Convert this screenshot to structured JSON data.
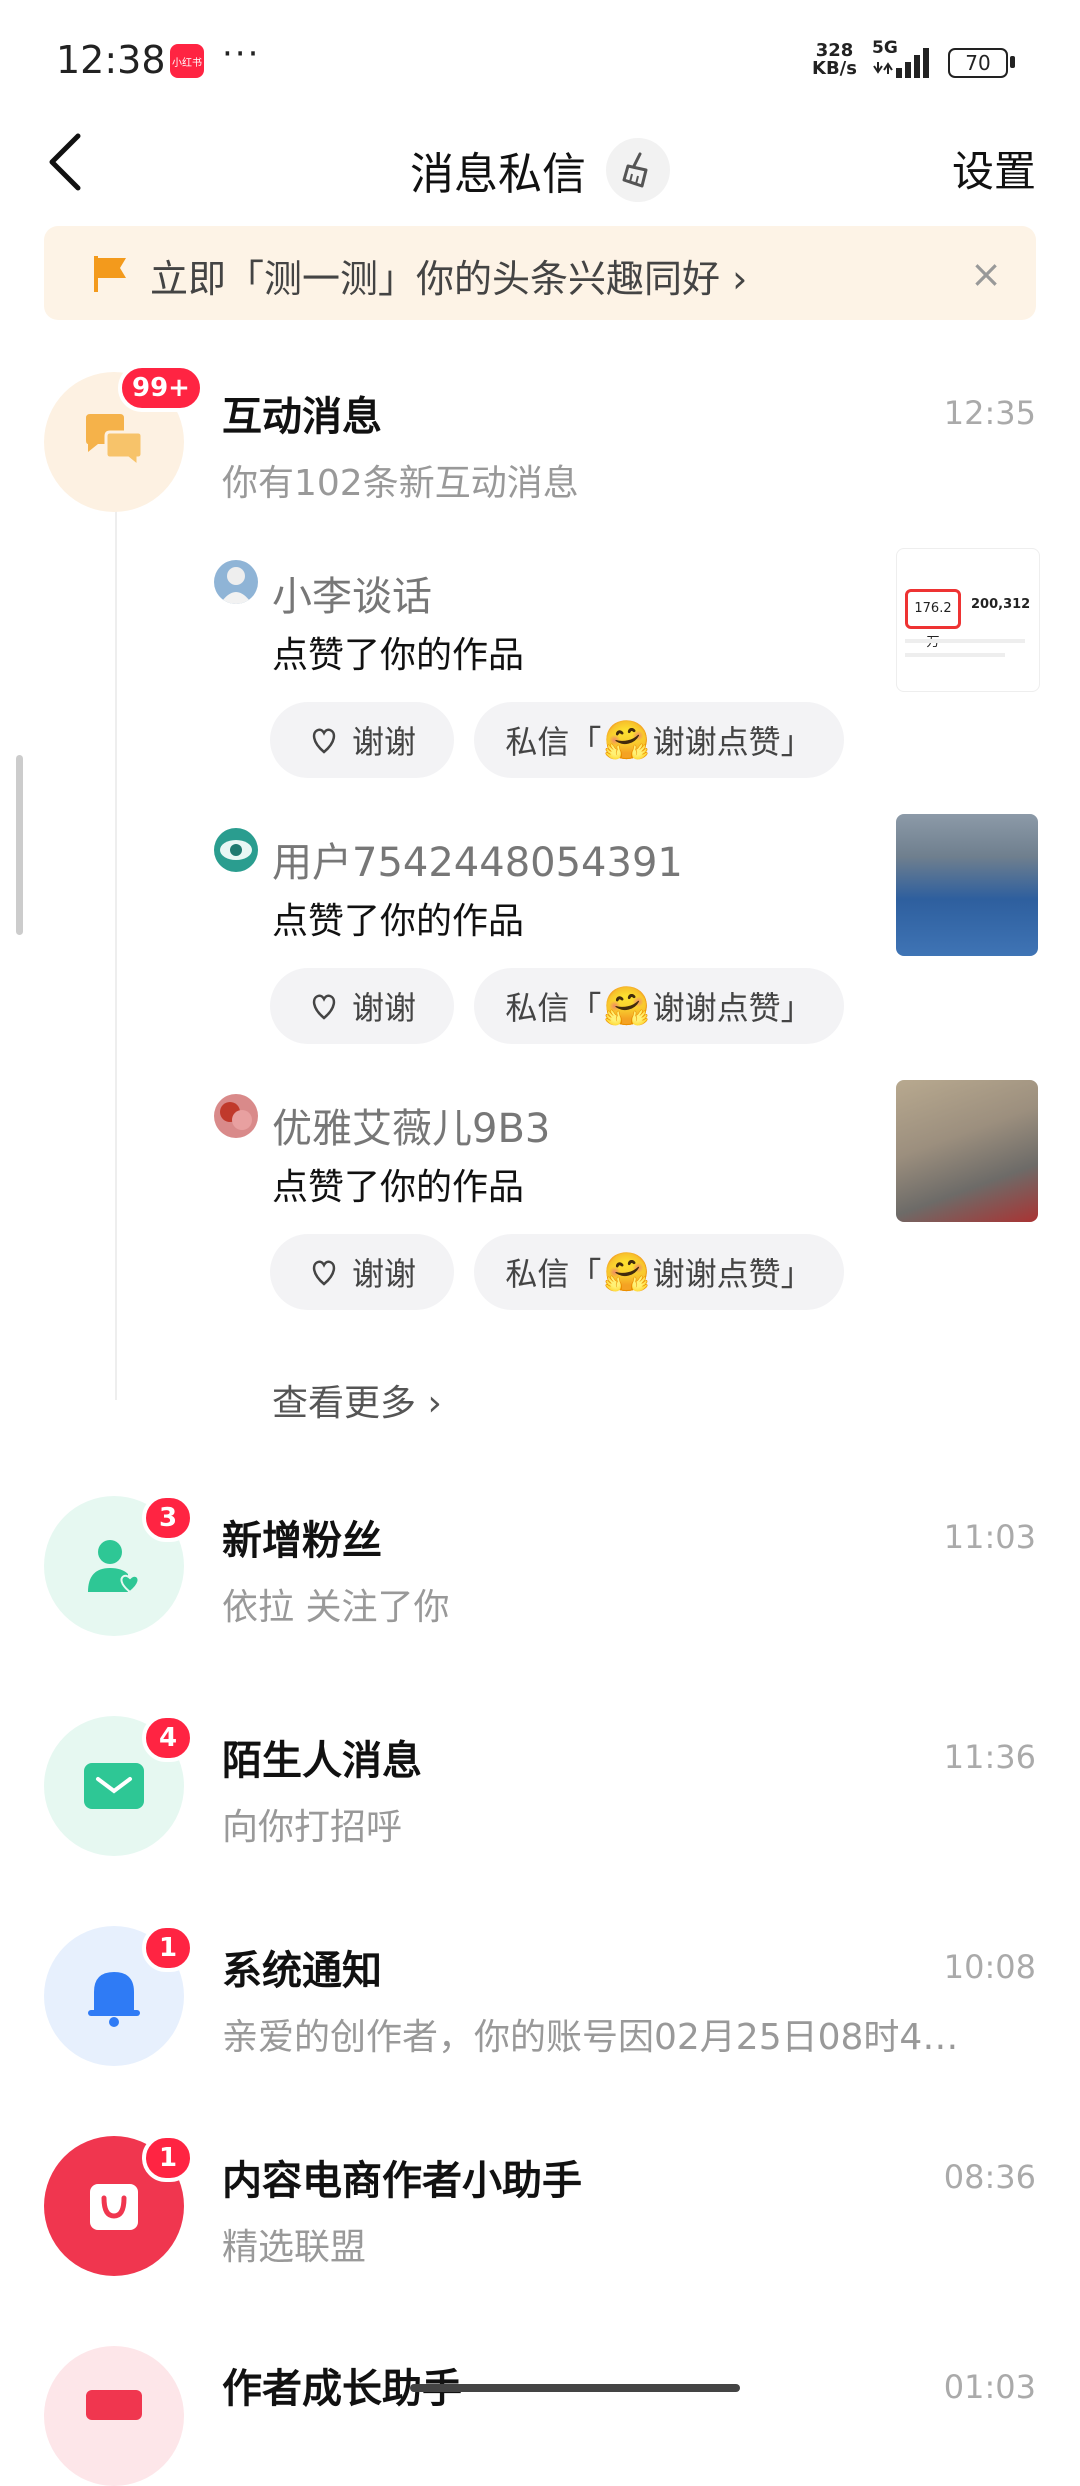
{
  "status_bar": {
    "time": "12:38",
    "app_icon_text": "小红书",
    "dots": "···",
    "net_speed_value": "328",
    "net_speed_unit": "KB/s",
    "network": "5G",
    "battery": "70"
  },
  "header": {
    "title": "消息私信",
    "settings_label": "设置"
  },
  "banner": {
    "text": "立即「测一测」你的头条兴趣同好 ›",
    "close": "×"
  },
  "interaction": {
    "title": "互动消息",
    "subtitle": "你有102条新互动消息",
    "time": "12:35",
    "badge": "99+",
    "items": [
      {
        "name": "小李谈话",
        "action": "点赞了你的作品",
        "thanks_label": "谢谢",
        "pm_prefix": "私信「",
        "pm_text": "谢谢点赞」",
        "thumb_texts": {
          "a": "176.2万",
          "b": "200,312"
        }
      },
      {
        "name": "用户7542448054391",
        "action": "点赞了你的作品",
        "thanks_label": "谢谢",
        "pm_prefix": "私信「",
        "pm_text": "谢谢点赞」"
      },
      {
        "name": "优雅艾薇儿9B3",
        "action": "点赞了你的作品",
        "thanks_label": "谢谢",
        "pm_prefix": "私信「",
        "pm_text": "谢谢点赞」"
      }
    ],
    "see_more": "查看更多 ›"
  },
  "rows": [
    {
      "title": "新增粉丝",
      "subtitle": "依拉 关注了你",
      "time": "11:03",
      "badge": "3",
      "icon": "person-heart-icon",
      "color": "#2ec795"
    },
    {
      "title": "陌生人消息",
      "subtitle": "向你打招呼",
      "time": "11:36",
      "badge": "4",
      "icon": "envelope-icon",
      "color": "#2ec795"
    },
    {
      "title": "系统通知",
      "subtitle": "亲爱的创作者，你的账号因02月25日08时4…",
      "time": "10:08",
      "badge": "1",
      "icon": "bell-icon",
      "color": "#2f7bf5"
    },
    {
      "title": "内容电商作者小助手",
      "subtitle": "精选联盟",
      "time": "08:36",
      "badge": "1",
      "icon": "shopping-bag-icon",
      "color": "#f0364f"
    },
    {
      "title": "作者成长助手",
      "subtitle": "",
      "time": "01:03",
      "badge": "",
      "icon": "growth-icon",
      "color": "#f0364f"
    }
  ]
}
